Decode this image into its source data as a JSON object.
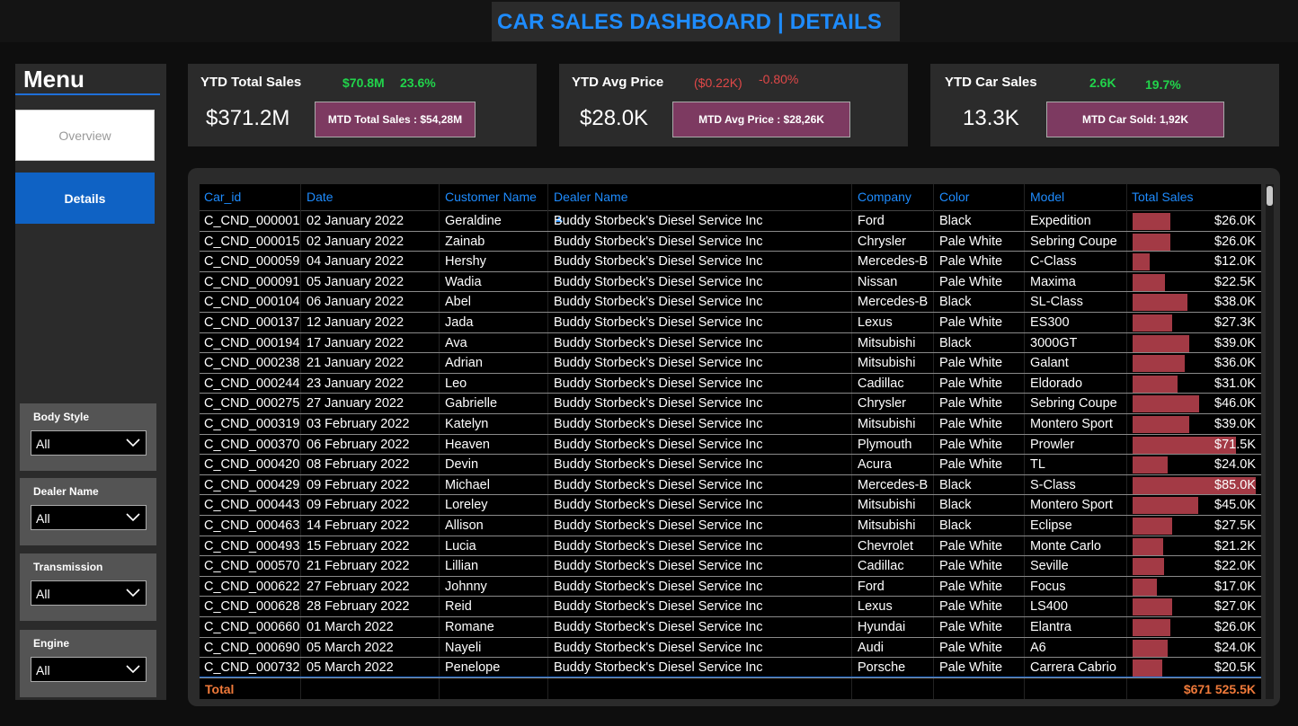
{
  "header": {
    "title": "CAR SALES DASHBOARD | DETAILS"
  },
  "menu": {
    "title": "Menu",
    "overview_label": "Overview",
    "details_label": "Details"
  },
  "slicers": [
    {
      "label": "Body Style",
      "value": "All"
    },
    {
      "label": "Dealer Name",
      "value": "All"
    },
    {
      "label": "Transmission",
      "value": "All"
    },
    {
      "label": "Engine",
      "value": "All"
    }
  ],
  "kpis": [
    {
      "label": "YTD Total Sales",
      "value": "$371.2M",
      "delta_value": "$70.8M",
      "delta_pct": "23.6%",
      "mtd_label": "MTD Total Sales : $54,28M"
    },
    {
      "label": "YTD Avg Price",
      "value": "$28.0K",
      "delta_value": "($0.22K)",
      "delta_pct": "-0.80%",
      "mtd_label": "MTD Avg Price : $28,26K"
    },
    {
      "label": "YTD Car Sales",
      "value": "13.3K",
      "delta_value": "2.6K",
      "delta_pct": "19.7%",
      "mtd_label": "MTD Car Sold: 1,92K"
    }
  ],
  "colors": {
    "accent": "#1e8cff",
    "positive": "#21d44b",
    "negative": "#e04848",
    "bar": "#a33a45",
    "mtd_button": "#7d3a61",
    "total": "#f07a3a"
  },
  "table": {
    "columns": [
      "Car_id",
      "Date",
      "Customer Name",
      "Dealer Name",
      "Company",
      "Color",
      "Model",
      "Total Sales"
    ],
    "sorted_column": "Dealer Name",
    "rows": [
      [
        "C_CND_000001",
        "02 January 2022",
        "Geraldine",
        "Buddy Storbeck's Diesel Service Inc",
        "Ford",
        "Black",
        "Expedition",
        "$26.0K"
      ],
      [
        "C_CND_000015",
        "02 January 2022",
        "Zainab",
        "Buddy Storbeck's Diesel Service Inc",
        "Chrysler",
        "Pale White",
        "Sebring Coupe",
        "$26.0K"
      ],
      [
        "C_CND_000059",
        "04 January 2022",
        "Hershy",
        "Buddy Storbeck's Diesel Service Inc",
        "Mercedes-B",
        "Pale White",
        "C-Class",
        "$12.0K"
      ],
      [
        "C_CND_000091",
        "05 January 2022",
        "Wadia",
        "Buddy Storbeck's Diesel Service Inc",
        "Nissan",
        "Pale White",
        "Maxima",
        "$22.5K"
      ],
      [
        "C_CND_000104",
        "06 January 2022",
        "Abel",
        "Buddy Storbeck's Diesel Service Inc",
        "Mercedes-B",
        "Black",
        "SL-Class",
        "$38.0K"
      ],
      [
        "C_CND_000137",
        "12 January 2022",
        "Jada",
        "Buddy Storbeck's Diesel Service Inc",
        "Lexus",
        "Pale White",
        "ES300",
        "$27.3K"
      ],
      [
        "C_CND_000194",
        "17 January 2022",
        "Ava",
        "Buddy Storbeck's Diesel Service Inc",
        "Mitsubishi",
        "Black",
        "3000GT",
        "$39.0K"
      ],
      [
        "C_CND_000238",
        "21 January 2022",
        "Adrian",
        "Buddy Storbeck's Diesel Service Inc",
        "Mitsubishi",
        "Pale White",
        "Galant",
        "$36.0K"
      ],
      [
        "C_CND_000244",
        "23 January 2022",
        "Leo",
        "Buddy Storbeck's Diesel Service Inc",
        "Cadillac",
        "Pale White",
        "Eldorado",
        "$31.0K"
      ],
      [
        "C_CND_000275",
        "27 January 2022",
        "Gabrielle",
        "Buddy Storbeck's Diesel Service Inc",
        "Chrysler",
        "Pale White",
        "Sebring Coupe",
        "$46.0K"
      ],
      [
        "C_CND_000319",
        "03 February 2022",
        "Katelyn",
        "Buddy Storbeck's Diesel Service Inc",
        "Mitsubishi",
        "Pale White",
        "Montero Sport",
        "$39.0K"
      ],
      [
        "C_CND_000370",
        "06 February 2022",
        "Heaven",
        "Buddy Storbeck's Diesel Service Inc",
        "Plymouth",
        "Pale White",
        "Prowler",
        "$71.5K"
      ],
      [
        "C_CND_000420",
        "08 February 2022",
        "Devin",
        "Buddy Storbeck's Diesel Service Inc",
        "Acura",
        "Pale White",
        "TL",
        "$24.0K"
      ],
      [
        "C_CND_000429",
        "09 February 2022",
        "Michael",
        "Buddy Storbeck's Diesel Service Inc",
        "Mercedes-B",
        "Black",
        "S-Class",
        "$85.0K"
      ],
      [
        "C_CND_000443",
        "09 February 2022",
        "Loreley",
        "Buddy Storbeck's Diesel Service Inc",
        "Mitsubishi",
        "Black",
        "Montero Sport",
        "$45.0K"
      ],
      [
        "C_CND_000463",
        "14 February 2022",
        "Allison",
        "Buddy Storbeck's Diesel Service Inc",
        "Mitsubishi",
        "Black",
        "Eclipse",
        "$27.5K"
      ],
      [
        "C_CND_000493",
        "15 February 2022",
        "Lucia",
        "Buddy Storbeck's Diesel Service Inc",
        "Chevrolet",
        "Pale White",
        "Monte Carlo",
        "$21.2K"
      ],
      [
        "C_CND_000570",
        "21 February 2022",
        "Lillian",
        "Buddy Storbeck's Diesel Service Inc",
        "Cadillac",
        "Pale White",
        "Seville",
        "$22.0K"
      ],
      [
        "C_CND_000622",
        "27 February 2022",
        "Johnny",
        "Buddy Storbeck's Diesel Service Inc",
        "Ford",
        "Pale White",
        "Focus",
        "$17.0K"
      ],
      [
        "C_CND_000628",
        "28 February 2022",
        "Reid",
        "Buddy Storbeck's Diesel Service Inc",
        "Lexus",
        "Pale White",
        "LS400",
        "$27.0K"
      ],
      [
        "C_CND_000660",
        "01 March 2022",
        "Romane",
        "Buddy Storbeck's Diesel Service Inc",
        "Hyundai",
        "Pale White",
        "Elantra",
        "$26.0K"
      ],
      [
        "C_CND_000690",
        "05 March 2022",
        "Nayeli",
        "Buddy Storbeck's Diesel Service Inc",
        "Audi",
        "Pale White",
        "A6",
        "$24.0K"
      ],
      [
        "C_CND_000732",
        "05 March 2022",
        "Penelope",
        "Buddy Storbeck's Diesel Service Inc",
        "Porsche",
        "Pale White",
        "Carrera Cabrio",
        "$20.5K"
      ]
    ],
    "sales_values_k": [
      26.0,
      26.0,
      12.0,
      22.5,
      38.0,
      27.3,
      39.0,
      36.0,
      31.0,
      46.0,
      39.0,
      71.5,
      24.0,
      85.0,
      45.0,
      27.5,
      21.2,
      22.0,
      17.0,
      27.0,
      26.0,
      24.0,
      20.5
    ],
    "sales_bar_max_k": 85.0,
    "total_label": "Total",
    "total_value": "$671 525.5K"
  }
}
